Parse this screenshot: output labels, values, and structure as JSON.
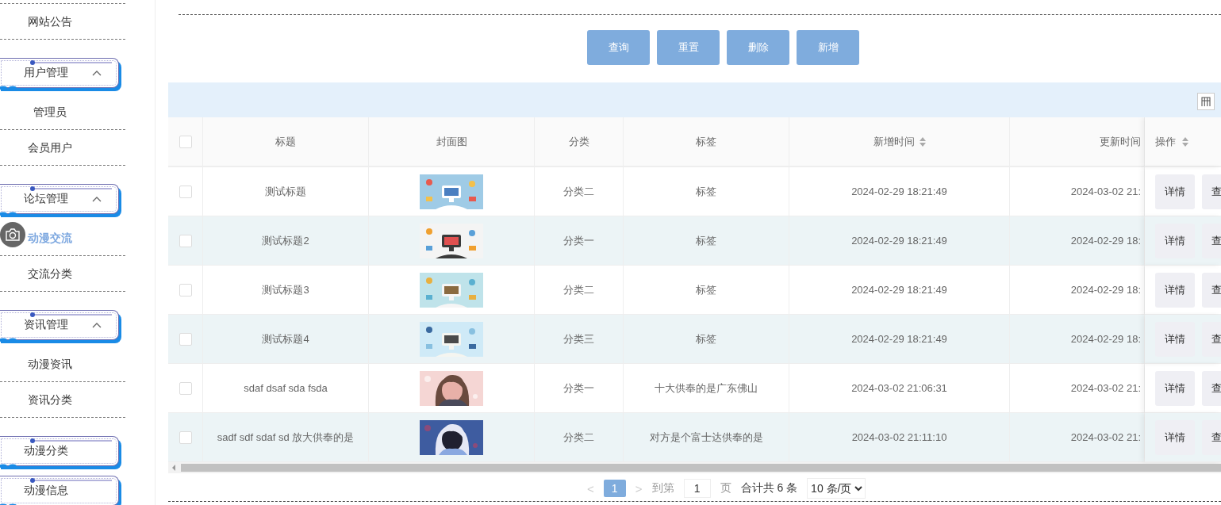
{
  "sidebar": {
    "items": [
      {
        "kind": "item",
        "label": "网站公告",
        "selected": false
      },
      {
        "kind": "group",
        "label": "用户管理",
        "expanded": true,
        "children": [
          {
            "label": "管理员",
            "selected": false
          },
          {
            "label": "会员用户",
            "selected": false
          }
        ]
      },
      {
        "kind": "group",
        "label": "论坛管理",
        "expanded": true,
        "children": [
          {
            "label": "动漫交流",
            "selected": true
          },
          {
            "label": "交流分类",
            "selected": false
          }
        ]
      },
      {
        "kind": "group",
        "label": "资讯管理",
        "expanded": true,
        "children": [
          {
            "label": "动漫资讯",
            "selected": false
          },
          {
            "label": "资讯分类",
            "selected": false
          }
        ]
      },
      {
        "kind": "group",
        "label": "动漫分类",
        "expanded": false
      },
      {
        "kind": "group",
        "label": "动漫信息",
        "expanded": false
      }
    ]
  },
  "toolbar": {
    "buttons": [
      "查询",
      "重置",
      "删除",
      "新增"
    ]
  },
  "table": {
    "header_checkbox": {
      "checked": false
    },
    "columns": [
      {
        "label": "标题",
        "sortable": false
      },
      {
        "label": "封面图",
        "sortable": false
      },
      {
        "label": "分类",
        "sortable": false
      },
      {
        "label": "标签",
        "sortable": false
      },
      {
        "label": "新增时间",
        "sortable": true
      },
      {
        "label": "更新时间",
        "sortable": false
      },
      {
        "label": "操作",
        "sortable": true
      }
    ],
    "rows": [
      {
        "checked": false,
        "title": "测试标题",
        "category": "分类二",
        "tag": "标签",
        "created": "2024-02-29 18:21:49",
        "updated": "2024-03-02 21:",
        "actions": [
          "详情",
          "查"
        ]
      },
      {
        "checked": false,
        "title": "测试标题2",
        "category": "分类一",
        "tag": "标签",
        "created": "2024-02-29 18:21:49",
        "updated": "2024-02-29 18:",
        "actions": [
          "详情",
          "查"
        ]
      },
      {
        "checked": false,
        "title": "测试标题3",
        "category": "分类二",
        "tag": "标签",
        "created": "2024-02-29 18:21:49",
        "updated": "2024-02-29 18:",
        "actions": [
          "详情",
          "查"
        ]
      },
      {
        "checked": false,
        "title": "测试标题4",
        "category": "分类三",
        "tag": "标签",
        "created": "2024-02-29 18:21:49",
        "updated": "2024-02-29 18:",
        "actions": [
          "详情",
          "查"
        ]
      },
      {
        "checked": false,
        "title": "sdaf dsaf sda fsda",
        "category": "分类一",
        "tag": "十大供奉的是广东佛山",
        "created": "2024-03-02 21:06:31",
        "updated": "2024-03-02 21:",
        "actions": [
          "详情",
          "查"
        ]
      },
      {
        "checked": false,
        "title": "sadf sdf sdaf sd 放大供奉的是",
        "category": "分类二",
        "tag": "对方是个富士达供奉的是",
        "created": "2024-03-02 21:11:10",
        "updated": "2024-03-02 21:",
        "actions": [
          "详情",
          "查"
        ]
      }
    ]
  },
  "pagination": {
    "prev": "<",
    "pages": [
      {
        "label": "1",
        "selected": true
      }
    ],
    "next": ">",
    "goto_label": "到第",
    "goto_value": "1",
    "page_unit": "页",
    "total": "合计共 6 条",
    "page_size": "10 条/页"
  }
}
